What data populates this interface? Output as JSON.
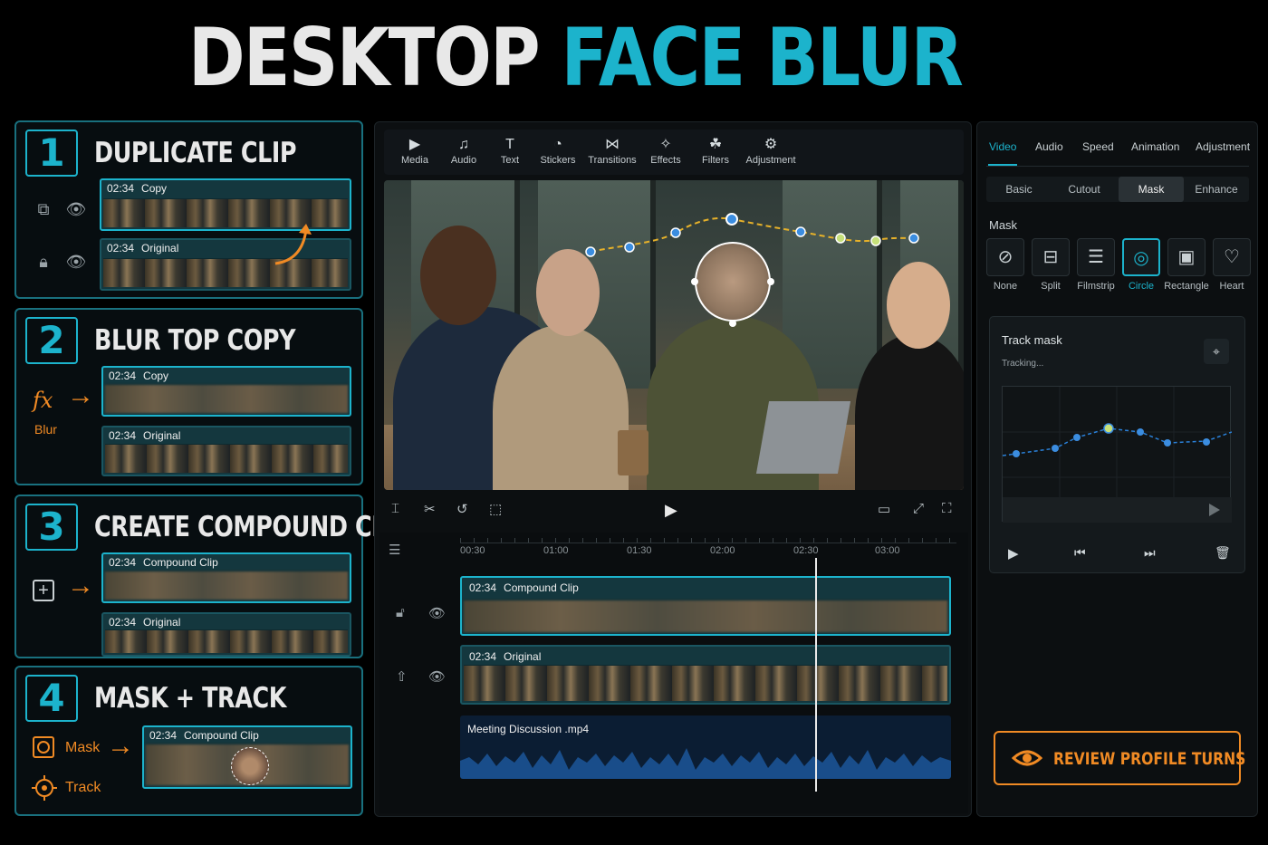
{
  "title": {
    "part1": "DESKTOP",
    "part2": "FACE BLUR"
  },
  "steps": [
    {
      "num": "1",
      "title": "DUPLICATE CLIP",
      "clips": [
        {
          "time": "02:34",
          "name": "Copy"
        },
        {
          "time": "02:34",
          "name": "Original"
        }
      ]
    },
    {
      "num": "2",
      "title": "BLUR TOP COPY",
      "fx_label": "Blur",
      "clips": [
        {
          "time": "02:34",
          "name": "Copy"
        },
        {
          "time": "02:34",
          "name": "Original"
        }
      ]
    },
    {
      "num": "3",
      "title": "CREATE COMPOUND CLIP",
      "clips": [
        {
          "time": "02:34",
          "name": "Compound Clip"
        },
        {
          "time": "02:34",
          "name": "Original"
        }
      ]
    },
    {
      "num": "4",
      "title": "MASK + TRACK",
      "mask_label": "Mask",
      "track_label": "Track",
      "clips": [
        {
          "time": "02:34",
          "name": "Compound Clip"
        }
      ]
    }
  ],
  "toolbar": {
    "items": [
      {
        "label": "Media",
        "icon": "media-icon"
      },
      {
        "label": "Audio",
        "icon": "audio-icon"
      },
      {
        "label": "Text",
        "icon": "text-icon"
      },
      {
        "label": "Stickers",
        "icon": "stickers-icon"
      },
      {
        "label": "Transitions",
        "icon": "transitions-icon"
      },
      {
        "label": "Effects",
        "icon": "effects-icon"
      },
      {
        "label": "Filters",
        "icon": "filters-icon"
      },
      {
        "label": "Adjustment",
        "icon": "adjustment-icon"
      }
    ]
  },
  "timeline": {
    "ticks": [
      "00:30",
      "01:00",
      "01:30",
      "02:00",
      "02:30",
      "03:00"
    ],
    "tracks": [
      {
        "time": "02:34",
        "name": "Compound Clip"
      },
      {
        "time": "02:34",
        "name": "Original"
      },
      {
        "name": "Meeting Discussion .mp4"
      }
    ]
  },
  "right_panel": {
    "tabs": [
      "Video",
      "Audio",
      "Speed",
      "Animation",
      "Adjustment"
    ],
    "active_tab": "Video",
    "subtabs": [
      "Basic",
      "Cutout",
      "Mask",
      "Enhance"
    ],
    "active_subtab": "Mask",
    "mask_heading": "Mask",
    "shapes": [
      "None",
      "Split",
      "Filmstrip",
      "Circle",
      "Rectangle",
      "Heart"
    ],
    "active_shape": "Circle",
    "track_mask": {
      "title": "Track mask",
      "status": "Tracking..."
    },
    "review_button": "REVIEW PROFILE TURNS"
  },
  "colors": {
    "accent": "#1cb3cc",
    "highlight": "#f08a24",
    "background": "#000000"
  }
}
